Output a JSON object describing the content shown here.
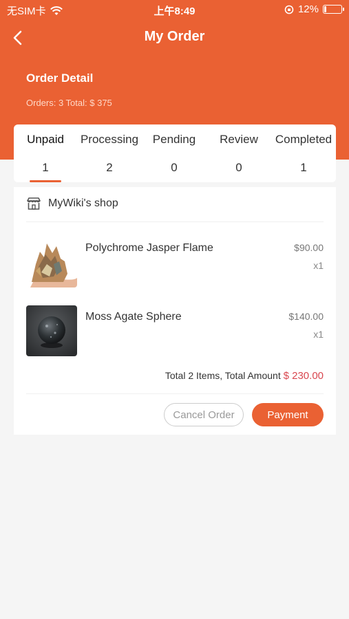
{
  "status_bar": {
    "carrier": "无SIM卡",
    "time": "上午8:49",
    "battery_percent": "12%",
    "battery_level": 0.12
  },
  "nav": {
    "title": "My Order",
    "back_icon": "chevron-left-icon"
  },
  "order_header": {
    "title": "Order Detail",
    "summary": "Orders: 3 Total: $ 375"
  },
  "tabs": [
    {
      "label": "Unpaid",
      "count": "1",
      "active": true
    },
    {
      "label": "Processing",
      "count": "2",
      "active": false
    },
    {
      "label": "Pending",
      "count": "0",
      "active": false
    },
    {
      "label": "Review",
      "count": "0",
      "active": false
    },
    {
      "label": "Completed",
      "count": "1",
      "active": false
    }
  ],
  "order": {
    "shop_name": "MyWiki's shop",
    "items": [
      {
        "name": "Polychrome Jasper Flame",
        "price": "$90.00",
        "qty": "x1"
      },
      {
        "name": "Moss Agate Sphere",
        "price": "$140.00",
        "qty": "x1"
      }
    ],
    "total_label": "Total 2 Items, Total Amount",
    "total_amount": "$ 230.00",
    "cancel_label": "Cancel Order",
    "pay_label": "Payment"
  },
  "colors": {
    "accent": "#ea6133",
    "total_red": "#d9474f",
    "background": "#f5f5f5"
  }
}
